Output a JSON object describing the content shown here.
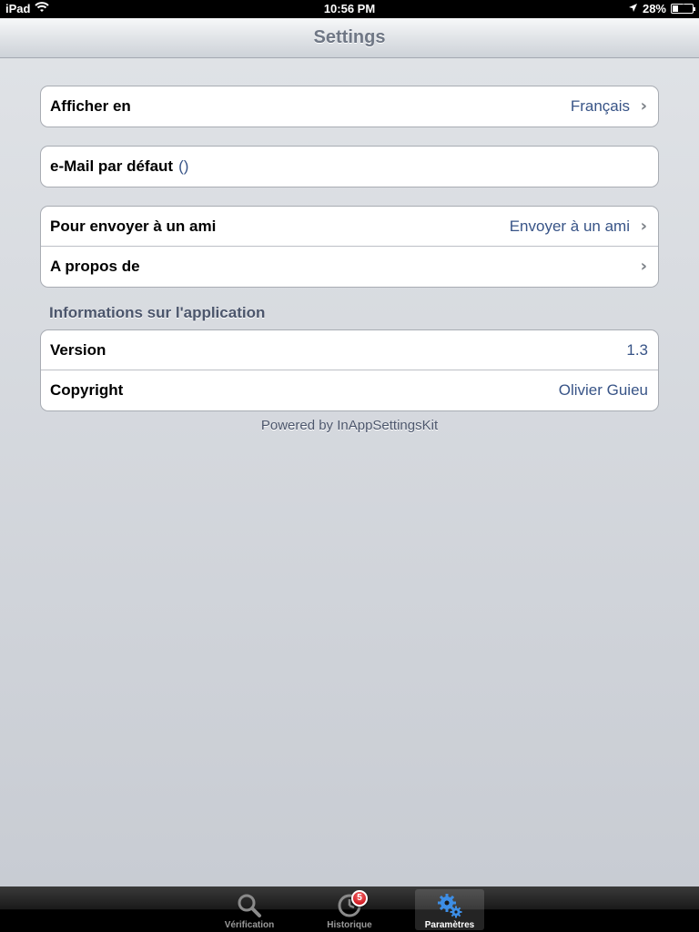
{
  "status_bar": {
    "device": "iPad",
    "time": "10:56 PM",
    "battery": "28%",
    "battery_level": 0.28
  },
  "nav": {
    "title": "Settings"
  },
  "groups": {
    "display": {
      "label": "Afficher en",
      "value": "Français"
    },
    "email": {
      "label": "e-Mail par défaut",
      "value": "()"
    },
    "share": {
      "send_label": "Pour envoyer à un ami",
      "send_value": "Envoyer à un ami",
      "about_label": "A propos de"
    },
    "app_info": {
      "header": "Informations sur l'application",
      "version_label": "Version",
      "version_value": "1.3",
      "copyright_label": "Copyright",
      "copyright_value": "Olivier Guieu"
    }
  },
  "footer": "Powered by InAppSettingsKit",
  "tab_bar": {
    "tabs": [
      {
        "label": "Vérification",
        "icon": "magnifier-icon",
        "selected": false
      },
      {
        "label": "Historique",
        "icon": "clock-icon",
        "badge": "5",
        "selected": false
      },
      {
        "label": "Paramètres",
        "icon": "gears-icon",
        "selected": true
      }
    ]
  },
  "colors": {
    "value_text": "#385487",
    "section_header": "#4c566c",
    "nav_title": "#6f7785",
    "selected_tab_icon": "#3d8ee6",
    "badge": "#c5000b"
  }
}
